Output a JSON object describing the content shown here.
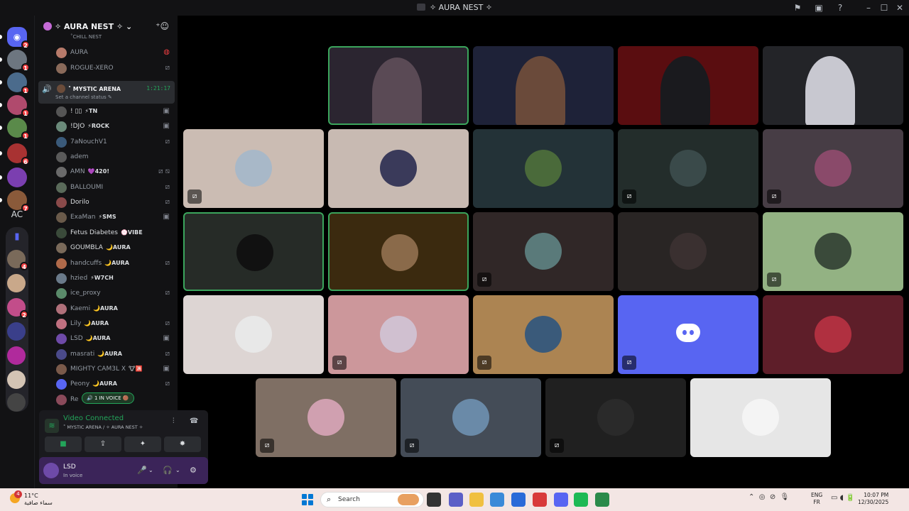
{
  "window": {
    "title": "✧ AURA NEST ✧"
  },
  "rail": {
    "servers": [
      {
        "name": "discord-home",
        "color": "#5865f2",
        "badge": "2"
      },
      {
        "name": "server-2",
        "color": "#6d7680",
        "badge": "1"
      },
      {
        "name": "server-3",
        "color": "#4b6b8c",
        "badge": "1"
      },
      {
        "name": "server-4",
        "color": "#b04a6d",
        "badge": "1"
      },
      {
        "name": "server-5",
        "color": "#5a8a4a",
        "badge": "1"
      },
      {
        "name": "server-6",
        "color": "#a83232",
        "badge": "6"
      },
      {
        "name": "server-7",
        "color": "#7b3fb0",
        "badge": ""
      },
      {
        "name": "server-8",
        "color": "#8a5a3a",
        "badge": "7"
      }
    ],
    "ac_label": "AC",
    "folder_servers": [
      {
        "name": "folder-server-1",
        "color": "#7a6a5a",
        "badge": "4"
      },
      {
        "name": "folder-server-2",
        "color": "#c9a88a",
        "badge": ""
      },
      {
        "name": "folder-server-3",
        "color": "#c24d8a",
        "badge": "2"
      },
      {
        "name": "folder-server-4",
        "color": "#3a3f8a",
        "badge": ""
      },
      {
        "name": "folder-server-5",
        "color": "#b02a9c",
        "badge": ""
      },
      {
        "name": "folder-server-6",
        "color": "#d4c4b4",
        "badge": ""
      },
      {
        "name": "folder-server-7",
        "color": "#444",
        "badge": ""
      }
    ]
  },
  "guild": {
    "name": "✧ AURA NEST ✧"
  },
  "chill_label": "˚CHILL NEST",
  "top_members": [
    {
      "name": "AURA",
      "color": "#b77a6a"
    },
    {
      "name": "ROGUE-XERO",
      "color": "#8a6a5a"
    }
  ],
  "channel": {
    "name": "˚ MYSTIC ARENA",
    "time": "1:21:17",
    "status": "Set a channel status"
  },
  "members": [
    {
      "name": "! ▯▯",
      "tag": "⚡TN",
      "tag_color": "#dbdee1",
      "bright": true,
      "state": "▣",
      "color": "#555"
    },
    {
      "name": "!DJO",
      "tag": "⚡ROCK",
      "tag_color": "#dbdee1",
      "bright": true,
      "state": "▣",
      "color": "#6a8a7a"
    },
    {
      "name": "7aNouchV1",
      "tag": "",
      "tag_color": "",
      "bright": false,
      "state": "⧄",
      "color": "#3a5a7a"
    },
    {
      "name": "adem",
      "tag": "",
      "tag_color": "",
      "bright": false,
      "state": "",
      "color": "#5a5a5a"
    },
    {
      "name": "AMN",
      "tag": "💜420!",
      "tag_color": "#dbdee1",
      "bright": false,
      "state": "⧄ ⧅",
      "color": "#6a6a6a"
    },
    {
      "name": "BALLOUMI",
      "tag": "",
      "tag_color": "",
      "bright": false,
      "state": "⧄",
      "color": "#5a6a5a"
    },
    {
      "name": "Dorilo",
      "tag": "",
      "tag_color": "",
      "bright": true,
      "state": "⧄",
      "color": "#8a4a4a"
    },
    {
      "name": "ExaMan",
      "tag": "⚡SMS",
      "tag_color": "#dbdee1",
      "bright": false,
      "state": "▣",
      "color": "#6a5a4a"
    },
    {
      "name": "Fetus Diabetes",
      "tag": "💮VIBE",
      "tag_color": "#dbdee1",
      "bright": true,
      "state": "",
      "color": "#3a4a3a"
    },
    {
      "name": "GOUMBLA",
      "tag": "🌙AURA",
      "tag_color": "#dbdee1",
      "bright": true,
      "state": "",
      "color": "#7a6a5a"
    },
    {
      "name": "handcuffs",
      "tag": "🌙AURA",
      "tag_color": "#dbdee1",
      "bright": false,
      "state": "⧄",
      "color": "#b06a4a"
    },
    {
      "name": "hzied",
      "tag": "⚡W7CH",
      "tag_color": "#dbdee1",
      "bright": false,
      "state": "",
      "color": "#6a7a8a"
    },
    {
      "name": "ice_proxy",
      "tag": "",
      "tag_color": "",
      "bright": false,
      "state": "⧄",
      "color": "#5a8a6a"
    },
    {
      "name": "Kaemi",
      "tag": "🌙AURA",
      "tag_color": "#dbdee1",
      "bright": false,
      "state": "",
      "color": "#b0707a"
    },
    {
      "name": "Lily",
      "tag": "🌙AURA",
      "tag_color": "#dbdee1",
      "bright": false,
      "state": "⧄",
      "color": "#c07080"
    },
    {
      "name": "LSD",
      "tag": "🌙AURA",
      "tag_color": "#dbdee1",
      "bright": false,
      "state": "▣",
      "color": "#6e4aa8"
    },
    {
      "name": "masrati",
      "tag": "🌙AURA",
      "tag_color": "#dbdee1",
      "bright": false,
      "state": "⧄",
      "color": "#4a4a8a"
    },
    {
      "name": "MIGHTY CAM3L X",
      "tag": "🐮🈵",
      "tag_color": "#dbdee1",
      "bright": false,
      "state": "▣",
      "color": "#7a5a4a"
    },
    {
      "name": "Peony",
      "tag": "🌙AURA",
      "tag_color": "#dbdee1",
      "bright": false,
      "state": "⧄",
      "color": "#5865f2"
    },
    {
      "name": "Re",
      "tag": "",
      "tag_color": "",
      "bright": false,
      "state": "",
      "color": "#8a4a5a"
    }
  ],
  "in_voice_badge": "🔊 1 IN VOICE 🟤",
  "voice": {
    "title": "Video Connected",
    "subtitle": "˚ MYSTIC ARENA / ✧ AURA NEST ✧",
    "buttons": [
      "▶ camera",
      "⇪ share",
      "✦ activity",
      "✸ soundboard"
    ]
  },
  "user": {
    "name": "LSD",
    "status": "In voice"
  },
  "tiles": [
    {
      "name": "video-user-1",
      "bg": "#2b2530",
      "speaking": true,
      "video": true,
      "muted": false,
      "avatar_color": "#5a4a55"
    },
    {
      "name": "video-user-2",
      "bg": "#1e2238",
      "speaking": false,
      "video": true,
      "muted": false,
      "avatar_color": "#6a4a3a"
    },
    {
      "name": "video-user-3",
      "bg": "#5a0d10",
      "speaking": false,
      "video": true,
      "muted": false,
      "avatar_color": "#1a1a1e"
    },
    {
      "name": "video-user-4",
      "bg": "#232428",
      "speaking": false,
      "video": true,
      "muted": false,
      "avatar_color": "#c8c8d0"
    },
    {
      "name": "tile-user-5",
      "bg": "#cbbcb3",
      "speaking": false,
      "video": false,
      "muted": true,
      "avatar_color": "#a8b8c8"
    },
    {
      "name": "tile-user-6",
      "bg": "#c8bab2",
      "speaking": false,
      "video": false,
      "muted": false,
      "avatar_color": "#3a3a5a"
    },
    {
      "name": "tile-user-7",
      "bg": "#233237",
      "speaking": false,
      "video": false,
      "muted": false,
      "avatar_color": "#4a6a3a"
    },
    {
      "name": "tile-user-8",
      "bg": "#232d2b",
      "speaking": false,
      "video": false,
      "muted": true,
      "avatar_color": "#3a4a4a"
    },
    {
      "name": "tile-user-9",
      "bg": "#473d45",
      "speaking": false,
      "video": false,
      "muted": true,
      "avatar_color": "#8a4a6a"
    },
    {
      "name": "tile-user-10",
      "bg": "#262b27",
      "speaking": true,
      "video": false,
      "muted": false,
      "avatar_color": "#111"
    },
    {
      "name": "tile-user-11",
      "bg": "#3b2a0f",
      "speaking": true,
      "video": false,
      "muted": false,
      "avatar_color": "#8a6a4a"
    },
    {
      "name": "tile-user-12",
      "bg": "#302727",
      "speaking": false,
      "video": false,
      "muted": true,
      "avatar_color": "#5a7a7a"
    },
    {
      "name": "tile-user-13",
      "bg": "#292524",
      "speaking": false,
      "video": false,
      "muted": false,
      "avatar_color": "#3a3030"
    },
    {
      "name": "tile-user-14",
      "bg": "#93b283",
      "speaking": false,
      "video": false,
      "muted": true,
      "avatar_color": "#3a4a3a"
    },
    {
      "name": "tile-user-15",
      "bg": "#ddd5d3",
      "speaking": false,
      "video": false,
      "muted": false,
      "avatar_color": "#e8e8e8"
    },
    {
      "name": "tile-user-16",
      "bg": "#cc979b",
      "speaking": false,
      "video": false,
      "muted": true,
      "avatar_color": "#d0c0d0"
    },
    {
      "name": "tile-user-17",
      "bg": "#ac8452",
      "speaking": false,
      "video": false,
      "muted": true,
      "avatar_color": "#3a5a7a"
    },
    {
      "name": "tile-user-18",
      "bg": "#5865f2",
      "speaking": false,
      "video": false,
      "muted": true,
      "avatar_color": "",
      "discord": true
    },
    {
      "name": "tile-user-19",
      "bg": "#5e1e29",
      "speaking": false,
      "video": false,
      "muted": false,
      "avatar_color": "#b03040"
    },
    {
      "name": "tile-user-20",
      "bg": "#7f6f64",
      "speaking": false,
      "video": false,
      "muted": true,
      "avatar_color": "#d0a0b0"
    },
    {
      "name": "tile-user-21",
      "bg": "#444c57",
      "speaking": false,
      "video": false,
      "muted": true,
      "avatar_color": "#6a8aa8"
    },
    {
      "name": "tile-user-22",
      "bg": "#202020",
      "speaking": false,
      "video": false,
      "muted": true,
      "avatar_color": "#2a2a2a"
    },
    {
      "name": "tile-user-23",
      "bg": "#e6e6e6",
      "speaking": false,
      "video": false,
      "muted": false,
      "avatar_color": "#f4f4f4"
    }
  ],
  "taskbar": {
    "weather_temp": "11°C",
    "weather_cond": "سماء صافية",
    "weather_badge": "4",
    "search_placeholder": "Search",
    "lang_line1": "ENG",
    "lang_line2": "FR",
    "time": "10:07 PM",
    "date": "12/30/2025",
    "apps": [
      {
        "name": "taskview-icon",
        "color": "#333"
      },
      {
        "name": "teams-icon",
        "color": "#5b5fc7"
      },
      {
        "name": "file-explorer-icon",
        "color": "#f0c040"
      },
      {
        "name": "copilot-icon",
        "color": "#3a8ad8"
      },
      {
        "name": "store-icon",
        "color": "#2a6ad8"
      },
      {
        "name": "opera-icon",
        "color": "#d83a3a"
      },
      {
        "name": "discord-taskbar-icon",
        "color": "#5865f2"
      },
      {
        "name": "spotify-icon",
        "color": "#1db954"
      },
      {
        "name": "terminal-icon",
        "color": "#2a8a4a"
      }
    ]
  }
}
